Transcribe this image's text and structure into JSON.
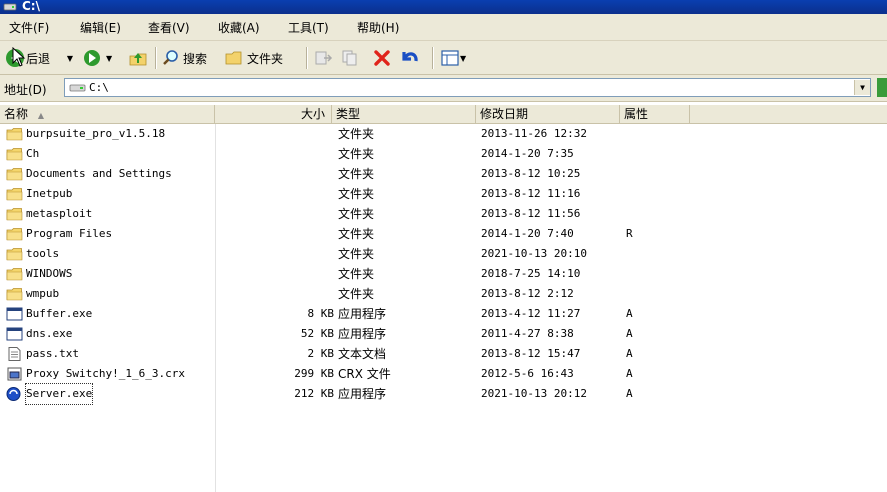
{
  "window": {
    "title": "C:\\"
  },
  "menu": [
    "文件(F)",
    "编辑(E)",
    "查看(V)",
    "收藏(A)",
    "工具(T)",
    "帮助(H)"
  ],
  "toolbar": {
    "back_label": "后退",
    "search_label": "搜索",
    "folders_label": "文件夹"
  },
  "address": {
    "label": "地址(D)",
    "value": "C:\\"
  },
  "columns": {
    "name": "名称",
    "size": "大小",
    "type": "类型",
    "modified": "修改日期",
    "attributes": "属性"
  },
  "files": [
    {
      "name": "burpsuite_pro_v1.5.18",
      "size": "",
      "type": "文件夹",
      "modified": "2013-11-26 12:32",
      "attr": "",
      "icon": "folder-icon"
    },
    {
      "name": "Ch",
      "size": "",
      "type": "文件夹",
      "modified": "2014-1-20 7:35",
      "attr": "",
      "icon": "folder-icon"
    },
    {
      "name": "Documents and Settings",
      "size": "",
      "type": "文件夹",
      "modified": "2013-8-12 10:25",
      "attr": "",
      "icon": "folder-icon"
    },
    {
      "name": "Inetpub",
      "size": "",
      "type": "文件夹",
      "modified": "2013-8-12 11:16",
      "attr": "",
      "icon": "folder-icon"
    },
    {
      "name": "metasploit",
      "size": "",
      "type": "文件夹",
      "modified": "2013-8-12 11:56",
      "attr": "",
      "icon": "folder-icon"
    },
    {
      "name": "Program Files",
      "size": "",
      "type": "文件夹",
      "modified": "2014-1-20 7:40",
      "attr": "R",
      "icon": "folder-icon"
    },
    {
      "name": "tools",
      "size": "",
      "type": "文件夹",
      "modified": "2021-10-13 20:10",
      "attr": "",
      "icon": "folder-icon"
    },
    {
      "name": "WINDOWS",
      "size": "",
      "type": "文件夹",
      "modified": "2018-7-25 14:10",
      "attr": "",
      "icon": "folder-icon"
    },
    {
      "name": "wmpub",
      "size": "",
      "type": "文件夹",
      "modified": "2013-8-12 2:12",
      "attr": "",
      "icon": "folder-icon"
    },
    {
      "name": "Buffer.exe",
      "size": "8 KB",
      "type": "应用程序",
      "modified": "2013-4-12 11:27",
      "attr": "A",
      "icon": "exe-icon"
    },
    {
      "name": "dns.exe",
      "size": "52 KB",
      "type": "应用程序",
      "modified": "2011-4-27 8:38",
      "attr": "A",
      "icon": "exe-icon"
    },
    {
      "name": "pass.txt",
      "size": "2 KB",
      "type": "文本文档",
      "modified": "2013-8-12 15:47",
      "attr": "A",
      "icon": "text-file-icon"
    },
    {
      "name": "Proxy Switchy!_1_6_3.crx",
      "size": "299 KB",
      "type": "CRX 文件",
      "modified": "2012-5-6 16:43",
      "attr": "A",
      "icon": "crx-file-icon"
    },
    {
      "name": "Server.exe",
      "size": "212 KB",
      "type": "应用程序",
      "modified": "2021-10-13 20:12",
      "attr": "A",
      "icon": "server-exe-icon"
    }
  ]
}
